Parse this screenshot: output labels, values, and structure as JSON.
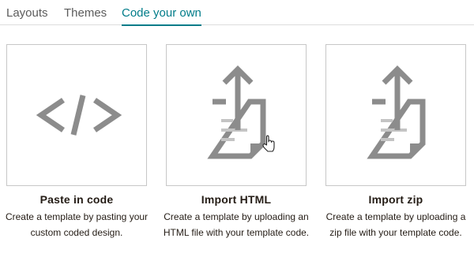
{
  "tabs": [
    {
      "label": "Layouts",
      "active": false
    },
    {
      "label": "Themes",
      "active": false
    },
    {
      "label": "Code your own",
      "active": true
    }
  ],
  "colors": {
    "accent": "#007c89",
    "icon_gray": "#8c8c8c",
    "icon_light": "#c4c4c4",
    "text": "#241c15",
    "tab_inactive": "#5b5b5b",
    "border": "#c7c7c7"
  },
  "options": [
    {
      "title": "Paste in code",
      "description": "Create a template by pasting your custom coded design.",
      "icon": "code-brackets-icon"
    },
    {
      "title": "Import HTML",
      "description": "Create a template by uploading an HTML file with your template code.",
      "icon": "upload-file-icon"
    },
    {
      "title": "Import zip",
      "description": "Create a template by uploading a zip file with your template code.",
      "icon": "upload-file-icon"
    }
  ],
  "cursor": "hand-pointer-cursor"
}
